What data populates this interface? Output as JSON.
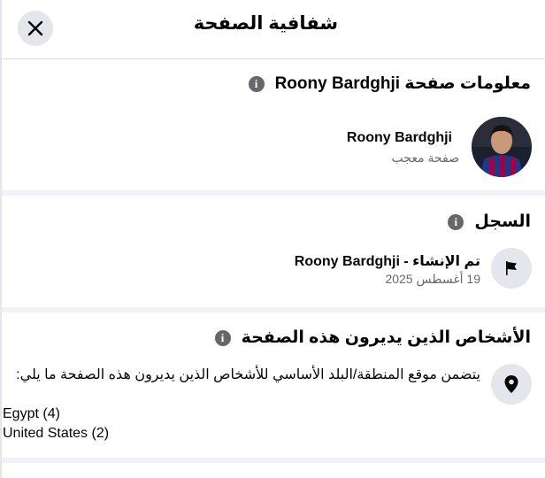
{
  "header": {
    "title": "شفافية الصفحة",
    "close_icon": "close-icon"
  },
  "page_info": {
    "title": "معلومات صفحة Roony Bardghji",
    "page_name": "Roony Bardghji",
    "category": "صفحة معجب"
  },
  "history": {
    "title": "السجل",
    "event": "تم الإنشاء - Roony Bardghji",
    "date": "19 أغسطس 2025",
    "icon": "flag-icon"
  },
  "managers": {
    "title": "الأشخاص الذين يديرون هذه الصفحة",
    "description": "يتضمن موقع المنطقة/البلد الأساسي للأشخاص الذين يديرون هذه الصفحة ما يلي:",
    "countries": [
      "Egypt (4)",
      "United States (2)"
    ],
    "icon": "location-pin-icon"
  },
  "colors": {
    "divider": "#f0f2f5",
    "icon_bg": "#e4e6eb",
    "secondary_text": "#65676b"
  }
}
